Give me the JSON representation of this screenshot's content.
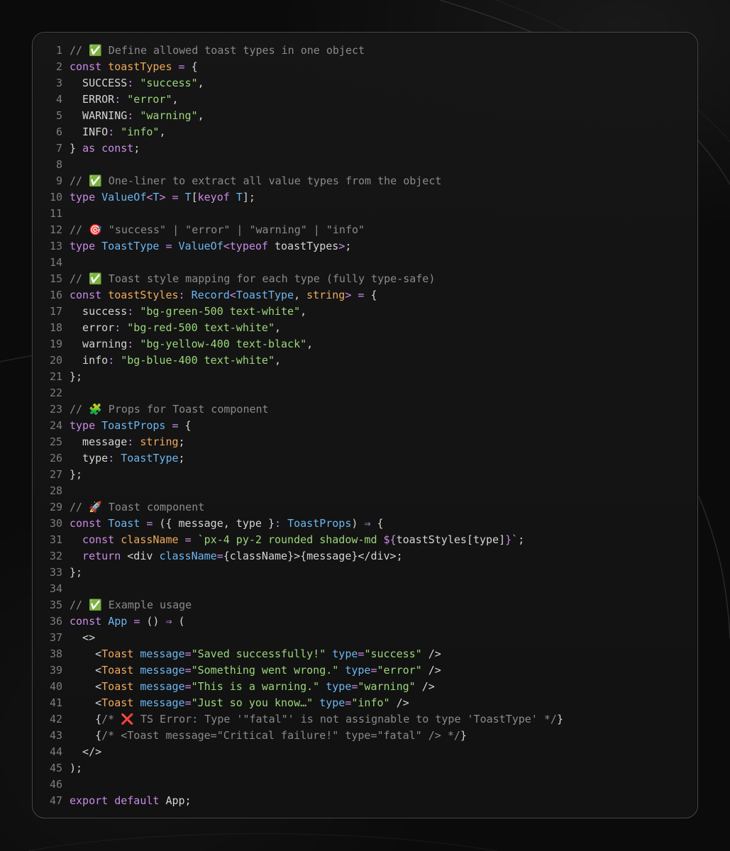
{
  "colors": {
    "background": "#0b0b0b",
    "card": "#161616",
    "card_border": "#4a4a4a",
    "line_number": "#7d7d7d",
    "comment": "#8a8a8a",
    "keyword": "#c98be6",
    "definition": "#f0a95b",
    "type": "#6cb6f0",
    "string": "#9bd67a",
    "plain": "#d4d4d4"
  },
  "editor": {
    "lines": [
      {
        "n": "1",
        "tokens": [
          {
            "c": "comment",
            "t": "// ✅ Define allowed toast types in one object"
          }
        ]
      },
      {
        "n": "2",
        "tokens": [
          {
            "c": "kw",
            "t": "const"
          },
          {
            "c": "plain",
            "t": " "
          },
          {
            "c": "def",
            "t": "toastTypes"
          },
          {
            "c": "plain",
            "t": " "
          },
          {
            "c": "kw",
            "t": "="
          },
          {
            "c": "plain",
            "t": " {"
          }
        ]
      },
      {
        "n": "3",
        "tokens": [
          {
            "c": "prop",
            "t": "  SUCCESS"
          },
          {
            "c": "kw",
            "t": ":"
          },
          {
            "c": "plain",
            "t": " "
          },
          {
            "c": "str",
            "t": "\"success\""
          },
          {
            "c": "plain",
            "t": ","
          }
        ]
      },
      {
        "n": "4",
        "tokens": [
          {
            "c": "prop",
            "t": "  ERROR"
          },
          {
            "c": "kw",
            "t": ":"
          },
          {
            "c": "plain",
            "t": " "
          },
          {
            "c": "str",
            "t": "\"error\""
          },
          {
            "c": "plain",
            "t": ","
          }
        ]
      },
      {
        "n": "5",
        "tokens": [
          {
            "c": "prop",
            "t": "  WARNING"
          },
          {
            "c": "kw",
            "t": ":"
          },
          {
            "c": "plain",
            "t": " "
          },
          {
            "c": "str",
            "t": "\"warning\""
          },
          {
            "c": "plain",
            "t": ","
          }
        ]
      },
      {
        "n": "6",
        "tokens": [
          {
            "c": "prop",
            "t": "  INFO"
          },
          {
            "c": "kw",
            "t": ":"
          },
          {
            "c": "plain",
            "t": " "
          },
          {
            "c": "str",
            "t": "\"info\""
          },
          {
            "c": "plain",
            "t": ","
          }
        ]
      },
      {
        "n": "7",
        "tokens": [
          {
            "c": "plain",
            "t": "} "
          },
          {
            "c": "kw",
            "t": "as"
          },
          {
            "c": "plain",
            "t": " "
          },
          {
            "c": "kw",
            "t": "const"
          },
          {
            "c": "plain",
            "t": ";"
          }
        ]
      },
      {
        "n": "8",
        "tokens": []
      },
      {
        "n": "9",
        "tokens": [
          {
            "c": "comment",
            "t": "// ✅ One-liner to extract all value types from the object"
          }
        ]
      },
      {
        "n": "10",
        "tokens": [
          {
            "c": "kw",
            "t": "type"
          },
          {
            "c": "plain",
            "t": " "
          },
          {
            "c": "type",
            "t": "ValueOf"
          },
          {
            "c": "kw",
            "t": "<"
          },
          {
            "c": "type",
            "t": "T"
          },
          {
            "c": "kw",
            "t": ">"
          },
          {
            "c": "plain",
            "t": " "
          },
          {
            "c": "kw",
            "t": "="
          },
          {
            "c": "plain",
            "t": " "
          },
          {
            "c": "type",
            "t": "T"
          },
          {
            "c": "plain",
            "t": "["
          },
          {
            "c": "kw",
            "t": "keyof"
          },
          {
            "c": "plain",
            "t": " "
          },
          {
            "c": "type",
            "t": "T"
          },
          {
            "c": "plain",
            "t": "];"
          }
        ]
      },
      {
        "n": "11",
        "tokens": []
      },
      {
        "n": "12",
        "tokens": [
          {
            "c": "comment",
            "t": "// 🎯 \"success\" | \"error\" | \"warning\" | \"info\""
          }
        ]
      },
      {
        "n": "13",
        "tokens": [
          {
            "c": "kw",
            "t": "type"
          },
          {
            "c": "plain",
            "t": " "
          },
          {
            "c": "type",
            "t": "ToastType"
          },
          {
            "c": "plain",
            "t": " "
          },
          {
            "c": "kw",
            "t": "="
          },
          {
            "c": "plain",
            "t": " "
          },
          {
            "c": "type",
            "t": "ValueOf"
          },
          {
            "c": "kw",
            "t": "<typeof"
          },
          {
            "c": "plain",
            "t": " toastTypes"
          },
          {
            "c": "kw",
            "t": ">"
          },
          {
            "c": "plain",
            "t": ";"
          }
        ]
      },
      {
        "n": "14",
        "tokens": []
      },
      {
        "n": "15",
        "tokens": [
          {
            "c": "comment",
            "t": "// ✅ Toast style mapping for each type (fully type-safe)"
          }
        ]
      },
      {
        "n": "16",
        "tokens": [
          {
            "c": "kw",
            "t": "const"
          },
          {
            "c": "plain",
            "t": " "
          },
          {
            "c": "def",
            "t": "toastStyles"
          },
          {
            "c": "kw",
            "t": ":"
          },
          {
            "c": "plain",
            "t": " "
          },
          {
            "c": "type",
            "t": "Record"
          },
          {
            "c": "kw",
            "t": "<"
          },
          {
            "c": "type",
            "t": "ToastType"
          },
          {
            "c": "plain",
            "t": ", "
          },
          {
            "c": "def",
            "t": "string"
          },
          {
            "c": "kw",
            "t": ">"
          },
          {
            "c": "plain",
            "t": " "
          },
          {
            "c": "kw",
            "t": "="
          },
          {
            "c": "plain",
            "t": " {"
          }
        ]
      },
      {
        "n": "17",
        "tokens": [
          {
            "c": "prop",
            "t": "  success"
          },
          {
            "c": "kw",
            "t": ":"
          },
          {
            "c": "plain",
            "t": " "
          },
          {
            "c": "str",
            "t": "\"bg-green-500 text-white\""
          },
          {
            "c": "plain",
            "t": ","
          }
        ]
      },
      {
        "n": "18",
        "tokens": [
          {
            "c": "prop",
            "t": "  error"
          },
          {
            "c": "kw",
            "t": ":"
          },
          {
            "c": "plain",
            "t": " "
          },
          {
            "c": "str",
            "t": "\"bg-red-500 text-white\""
          },
          {
            "c": "plain",
            "t": ","
          }
        ]
      },
      {
        "n": "19",
        "tokens": [
          {
            "c": "prop",
            "t": "  warning"
          },
          {
            "c": "kw",
            "t": ":"
          },
          {
            "c": "plain",
            "t": " "
          },
          {
            "c": "str",
            "t": "\"bg-yellow-400 text-black\""
          },
          {
            "c": "plain",
            "t": ","
          }
        ]
      },
      {
        "n": "20",
        "tokens": [
          {
            "c": "prop",
            "t": "  info"
          },
          {
            "c": "kw",
            "t": ":"
          },
          {
            "c": "plain",
            "t": " "
          },
          {
            "c": "str",
            "t": "\"bg-blue-400 text-white\""
          },
          {
            "c": "plain",
            "t": ","
          }
        ]
      },
      {
        "n": "21",
        "tokens": [
          {
            "c": "plain",
            "t": "};"
          }
        ]
      },
      {
        "n": "22",
        "tokens": []
      },
      {
        "n": "23",
        "tokens": [
          {
            "c": "comment",
            "t": "// 🧩 Props for Toast component"
          }
        ]
      },
      {
        "n": "24",
        "tokens": [
          {
            "c": "kw",
            "t": "type"
          },
          {
            "c": "plain",
            "t": " "
          },
          {
            "c": "type",
            "t": "ToastProps"
          },
          {
            "c": "plain",
            "t": " "
          },
          {
            "c": "kw",
            "t": "="
          },
          {
            "c": "plain",
            "t": " {"
          }
        ]
      },
      {
        "n": "25",
        "tokens": [
          {
            "c": "prop",
            "t": "  message"
          },
          {
            "c": "kw",
            "t": ":"
          },
          {
            "c": "plain",
            "t": " "
          },
          {
            "c": "def",
            "t": "string"
          },
          {
            "c": "plain",
            "t": ";"
          }
        ]
      },
      {
        "n": "26",
        "tokens": [
          {
            "c": "prop",
            "t": "  type"
          },
          {
            "c": "kw",
            "t": ":"
          },
          {
            "c": "plain",
            "t": " "
          },
          {
            "c": "type",
            "t": "ToastType"
          },
          {
            "c": "plain",
            "t": ";"
          }
        ]
      },
      {
        "n": "27",
        "tokens": [
          {
            "c": "plain",
            "t": "};"
          }
        ]
      },
      {
        "n": "28",
        "tokens": []
      },
      {
        "n": "29",
        "tokens": [
          {
            "c": "comment",
            "t": "// 🚀 Toast component"
          }
        ]
      },
      {
        "n": "30",
        "tokens": [
          {
            "c": "kw",
            "t": "const"
          },
          {
            "c": "plain",
            "t": " "
          },
          {
            "c": "type",
            "t": "Toast"
          },
          {
            "c": "plain",
            "t": " "
          },
          {
            "c": "kw",
            "t": "="
          },
          {
            "c": "plain",
            "t": " ({ message, type }"
          },
          {
            "c": "kw",
            "t": ":"
          },
          {
            "c": "plain",
            "t": " "
          },
          {
            "c": "type",
            "t": "ToastProps"
          },
          {
            "c": "plain",
            "t": ") "
          },
          {
            "c": "kw",
            "t": "⇒"
          },
          {
            "c": "plain",
            "t": " {"
          }
        ]
      },
      {
        "n": "31",
        "tokens": [
          {
            "c": "kw",
            "t": "  const"
          },
          {
            "c": "plain",
            "t": " "
          },
          {
            "c": "def",
            "t": "className"
          },
          {
            "c": "plain",
            "t": " "
          },
          {
            "c": "kw",
            "t": "="
          },
          {
            "c": "plain",
            "t": " "
          },
          {
            "c": "str",
            "t": "`px-4 py-2 rounded shadow-md "
          },
          {
            "c": "kw",
            "t": "${"
          },
          {
            "c": "plain",
            "t": "toastStyles[type]"
          },
          {
            "c": "kw",
            "t": "}"
          },
          {
            "c": "str",
            "t": "`"
          },
          {
            "c": "plain",
            "t": ";"
          }
        ]
      },
      {
        "n": "32",
        "tokens": [
          {
            "c": "kw",
            "t": "  return"
          },
          {
            "c": "plain",
            "t": " <div "
          },
          {
            "c": "attr",
            "t": "className"
          },
          {
            "c": "kw",
            "t": "="
          },
          {
            "c": "plain",
            "t": "{className}>{message}</div>;"
          }
        ]
      },
      {
        "n": "33",
        "tokens": [
          {
            "c": "plain",
            "t": "};"
          }
        ]
      },
      {
        "n": "34",
        "tokens": []
      },
      {
        "n": "35",
        "tokens": [
          {
            "c": "comment",
            "t": "// ✅ Example usage"
          }
        ]
      },
      {
        "n": "36",
        "tokens": [
          {
            "c": "kw",
            "t": "const"
          },
          {
            "c": "plain",
            "t": " "
          },
          {
            "c": "type",
            "t": "App"
          },
          {
            "c": "plain",
            "t": " "
          },
          {
            "c": "kw",
            "t": "="
          },
          {
            "c": "plain",
            "t": " () "
          },
          {
            "c": "kw",
            "t": "⇒"
          },
          {
            "c": "plain",
            "t": " ("
          }
        ]
      },
      {
        "n": "37",
        "tokens": [
          {
            "c": "plain",
            "t": "  <>"
          }
        ]
      },
      {
        "n": "38",
        "tokens": [
          {
            "c": "plain",
            "t": "    <"
          },
          {
            "c": "tag",
            "t": "Toast"
          },
          {
            "c": "plain",
            "t": " "
          },
          {
            "c": "attr",
            "t": "message"
          },
          {
            "c": "kw",
            "t": "="
          },
          {
            "c": "str",
            "t": "\"Saved successfully!\""
          },
          {
            "c": "plain",
            "t": " "
          },
          {
            "c": "attr",
            "t": "type"
          },
          {
            "c": "kw",
            "t": "="
          },
          {
            "c": "str",
            "t": "\"success\""
          },
          {
            "c": "plain",
            "t": " />"
          }
        ]
      },
      {
        "n": "39",
        "tokens": [
          {
            "c": "plain",
            "t": "    <"
          },
          {
            "c": "tag",
            "t": "Toast"
          },
          {
            "c": "plain",
            "t": " "
          },
          {
            "c": "attr",
            "t": "message"
          },
          {
            "c": "kw",
            "t": "="
          },
          {
            "c": "str",
            "t": "\"Something went wrong.\""
          },
          {
            "c": "plain",
            "t": " "
          },
          {
            "c": "attr",
            "t": "type"
          },
          {
            "c": "kw",
            "t": "="
          },
          {
            "c": "str",
            "t": "\"error\""
          },
          {
            "c": "plain",
            "t": " />"
          }
        ]
      },
      {
        "n": "40",
        "tokens": [
          {
            "c": "plain",
            "t": "    <"
          },
          {
            "c": "tag",
            "t": "Toast"
          },
          {
            "c": "plain",
            "t": " "
          },
          {
            "c": "attr",
            "t": "message"
          },
          {
            "c": "kw",
            "t": "="
          },
          {
            "c": "str",
            "t": "\"This is a warning.\""
          },
          {
            "c": "plain",
            "t": " "
          },
          {
            "c": "attr",
            "t": "type"
          },
          {
            "c": "kw",
            "t": "="
          },
          {
            "c": "str",
            "t": "\"warning\""
          },
          {
            "c": "plain",
            "t": " />"
          }
        ]
      },
      {
        "n": "41",
        "tokens": [
          {
            "c": "plain",
            "t": "    <"
          },
          {
            "c": "tag",
            "t": "Toast"
          },
          {
            "c": "plain",
            "t": " "
          },
          {
            "c": "attr",
            "t": "message"
          },
          {
            "c": "kw",
            "t": "="
          },
          {
            "c": "str",
            "t": "\"Just so you know…\""
          },
          {
            "c": "plain",
            "t": " "
          },
          {
            "c": "attr",
            "t": "type"
          },
          {
            "c": "kw",
            "t": "="
          },
          {
            "c": "str",
            "t": "\"info\""
          },
          {
            "c": "plain",
            "t": " />"
          }
        ]
      },
      {
        "n": "42",
        "tokens": [
          {
            "c": "plain",
            "t": "    {"
          },
          {
            "c": "comment",
            "t": "/* ❌ TS Error: Type '\"fatal\"' is not assignable to type 'ToastType' */"
          },
          {
            "c": "plain",
            "t": "}"
          }
        ]
      },
      {
        "n": "43",
        "tokens": [
          {
            "c": "plain",
            "t": "    {"
          },
          {
            "c": "comment",
            "t": "/* <Toast message=\"Critical failure!\" type=\"fatal\" /> */"
          },
          {
            "c": "plain",
            "t": "}"
          }
        ]
      },
      {
        "n": "44",
        "tokens": [
          {
            "c": "plain",
            "t": "  </>"
          }
        ]
      },
      {
        "n": "45",
        "tokens": [
          {
            "c": "plain",
            "t": ");"
          }
        ]
      },
      {
        "n": "46",
        "tokens": []
      },
      {
        "n": "47",
        "tokens": [
          {
            "c": "kw",
            "t": "export"
          },
          {
            "c": "plain",
            "t": " "
          },
          {
            "c": "kw",
            "t": "default"
          },
          {
            "c": "plain",
            "t": " App;"
          }
        ]
      }
    ]
  }
}
